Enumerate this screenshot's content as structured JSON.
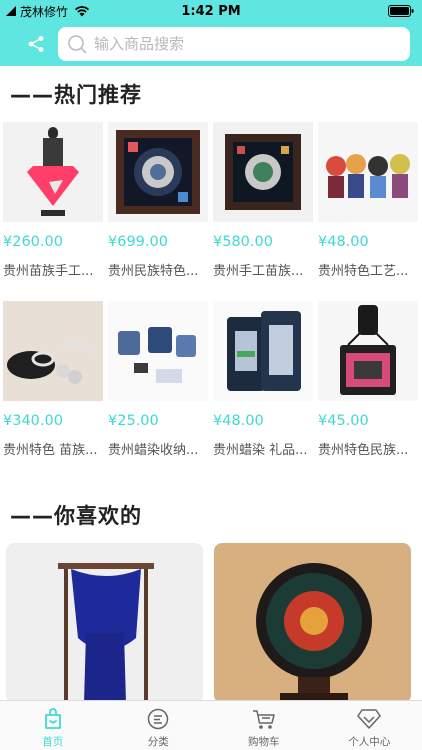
{
  "status_bar": {
    "carrier": "茂林修竹",
    "time": "1:42 PM"
  },
  "header": {
    "search_placeholder": "输入商品搜索"
  },
  "hot": {
    "title": "——热门推荐",
    "items": [
      {
        "price": "¥260.00",
        "name": "贵州苗族手工..."
      },
      {
        "price": "¥699.00",
        "name": "贵州民族特色..."
      },
      {
        "price": "¥580.00",
        "name": "贵州手工苗族..."
      },
      {
        "price": "¥48.00",
        "name": "贵州特色工艺..."
      },
      {
        "price": "¥340.00",
        "name": "贵州特色 苗族..."
      },
      {
        "price": "¥25.00",
        "name": "贵州蜡染收纳..."
      },
      {
        "price": "¥48.00",
        "name": "贵州蜡染 礼品..."
      },
      {
        "price": "¥45.00",
        "name": "贵州特色民族..."
      }
    ]
  },
  "like": {
    "title": "——你喜欢的"
  },
  "tabbar": {
    "items": [
      {
        "label": "首页",
        "icon": "home-bag-icon",
        "active": true
      },
      {
        "label": "分类",
        "icon": "category-icon",
        "active": false
      },
      {
        "label": "购物车",
        "icon": "cart-icon",
        "active": false
      },
      {
        "label": "个人中心",
        "icon": "diamond-icon",
        "active": false
      }
    ]
  },
  "colors": {
    "accent": "#5fe6e0",
    "price": "#3fd9d4"
  }
}
